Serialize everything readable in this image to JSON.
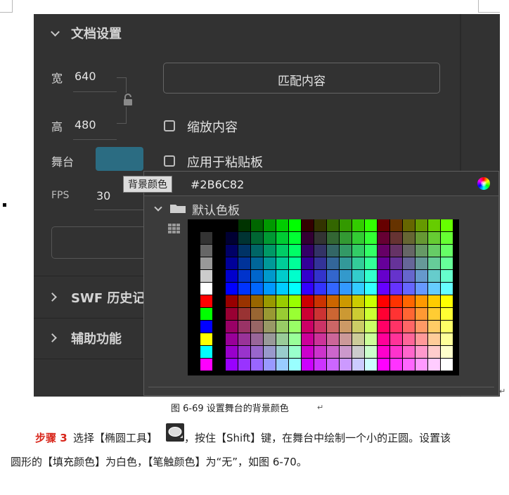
{
  "panel": {
    "doc_settings_title": "文档设置",
    "width_label": "宽",
    "width_value": "640",
    "height_label": "高",
    "height_value": "480",
    "match_content_button": "匹配内容",
    "scale_content_label": "缩放内容",
    "apply_pasteboard_label": "应用于粘贴板",
    "stage_label": "舞台",
    "fps_label": "FPS",
    "fps_value": "30",
    "swf_history_title": "SWF 历史记",
    "accessibility_title": "辅助功能",
    "stage_color": "#2B6C82"
  },
  "color_popup": {
    "tooltip": "背景颜色",
    "hex_value": "#2B6C82",
    "palette_title": "默认色板"
  },
  "caption": {
    "figure_label": "图 6-69  设置舞台的背景颜色",
    "step_label": "步骤 3",
    "line1_part1": "选择【椭圆工具】",
    "line1_part2": "，按住【Shift】键，在舞台中绘制一个小的正圆。设置该",
    "line2": "圆形的【填充颜色】为白色，【笔触颜色】为“无”，如图 6-70。",
    "return_mark": "↵"
  },
  "colors": {
    "panel_bg": "#323232",
    "step_red": "#d8261b"
  }
}
